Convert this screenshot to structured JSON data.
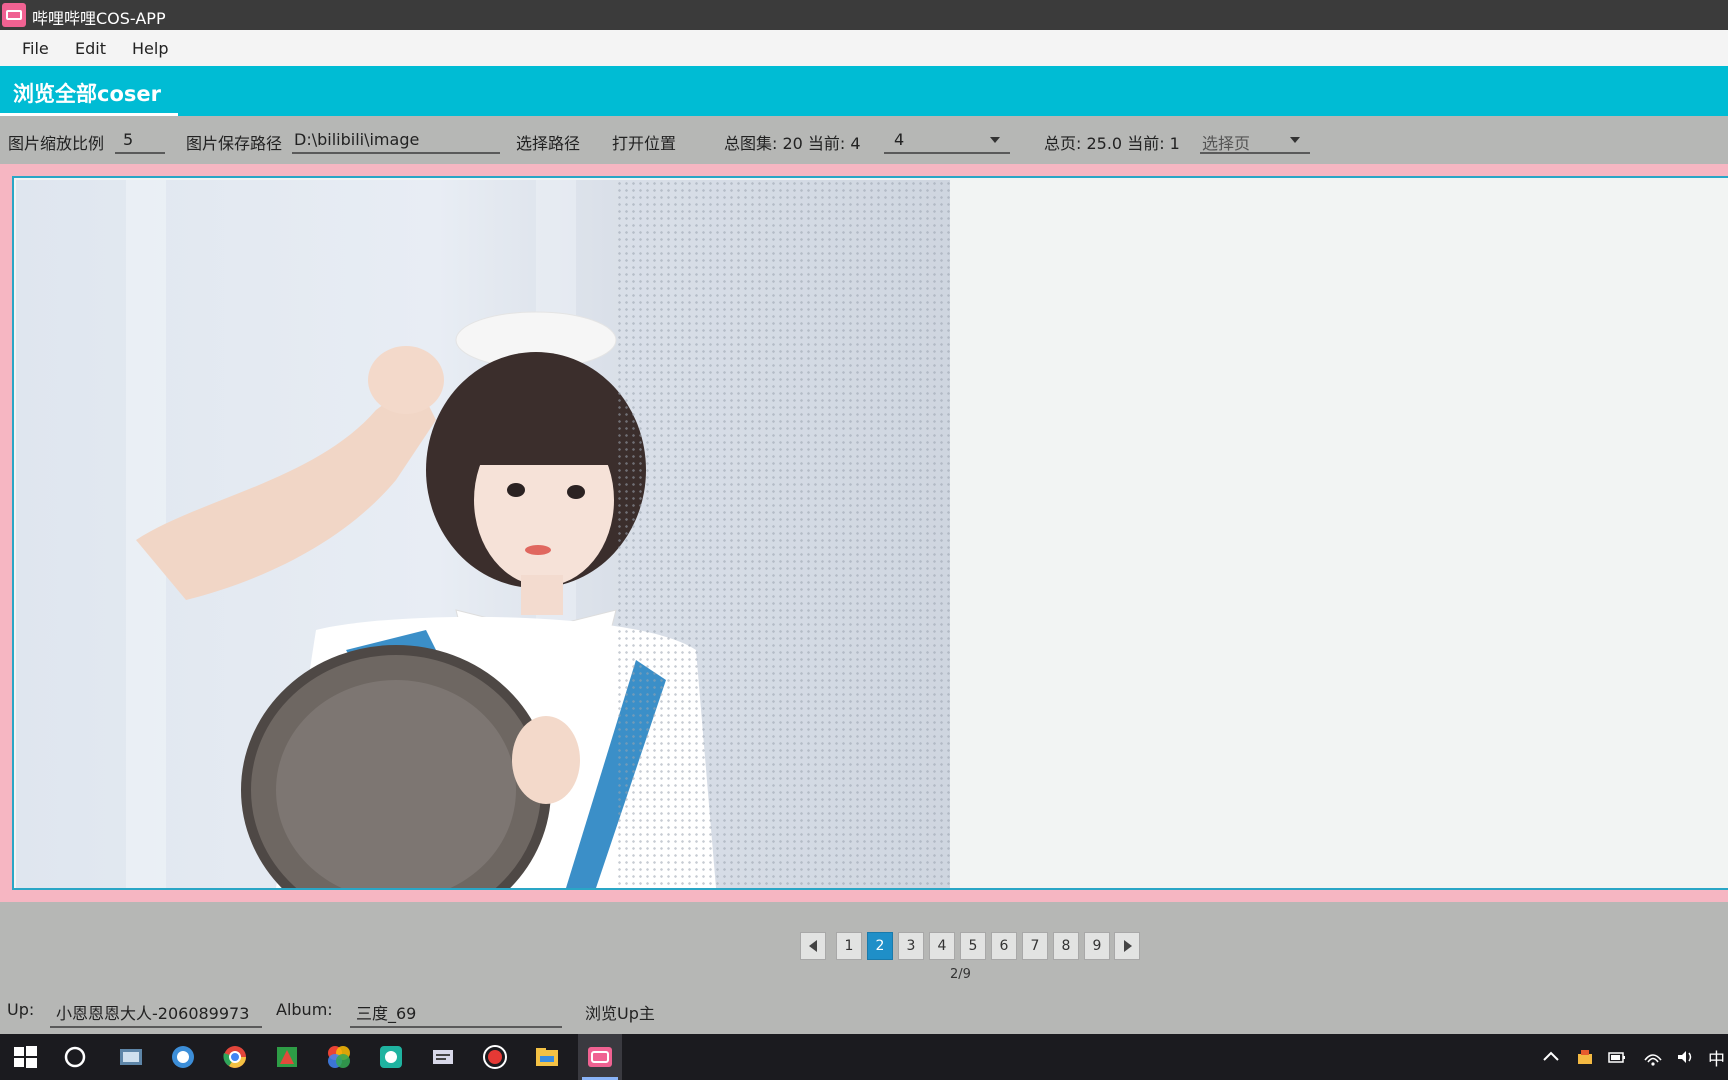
{
  "window": {
    "title": "哔哩哔哩COS-APP"
  },
  "menu": {
    "file": "File",
    "edit": "Edit",
    "help": "Help"
  },
  "tabs": [
    {
      "label": "浏览全部coser",
      "active": true
    }
  ],
  "toolbar": {
    "scale_label": "图片缩放比例",
    "scale_value": "5",
    "save_path_label": "图片保存路径",
    "save_path_value": "D:\\bilibili\\image",
    "choose_path": "选择路径",
    "open_location": "打开位置",
    "total_albums_label": "总图集: 20 当前: 4",
    "album_select_value": "4",
    "total_pages_label": "总页: 25.0 当前: 1",
    "page_select_placeholder": "选择页"
  },
  "pagination": {
    "pages": [
      "1",
      "2",
      "3",
      "4",
      "5",
      "6",
      "7",
      "8",
      "9"
    ],
    "current": "2",
    "status": "2/9"
  },
  "footer": {
    "up_label": "Up:",
    "up_value": "小恩恩恩大人-206089973",
    "album_label": "Album:",
    "album_value": "三度_69",
    "browse_up": "浏览Up主"
  },
  "taskbar": {
    "ime": "中",
    "apps": [
      "start-icon",
      "search-icon",
      "file-manager-icon",
      "browser-icon",
      "chrome-icon",
      "office-icon",
      "color-app-icon",
      "camera-app-icon",
      "editor-icon",
      "recorder-icon",
      "folder-icon",
      "bili-app-icon"
    ]
  },
  "colors": {
    "accent": "#00bcd4",
    "viewer_border": "#f6b6c2",
    "active_page": "#1f8fc8"
  }
}
